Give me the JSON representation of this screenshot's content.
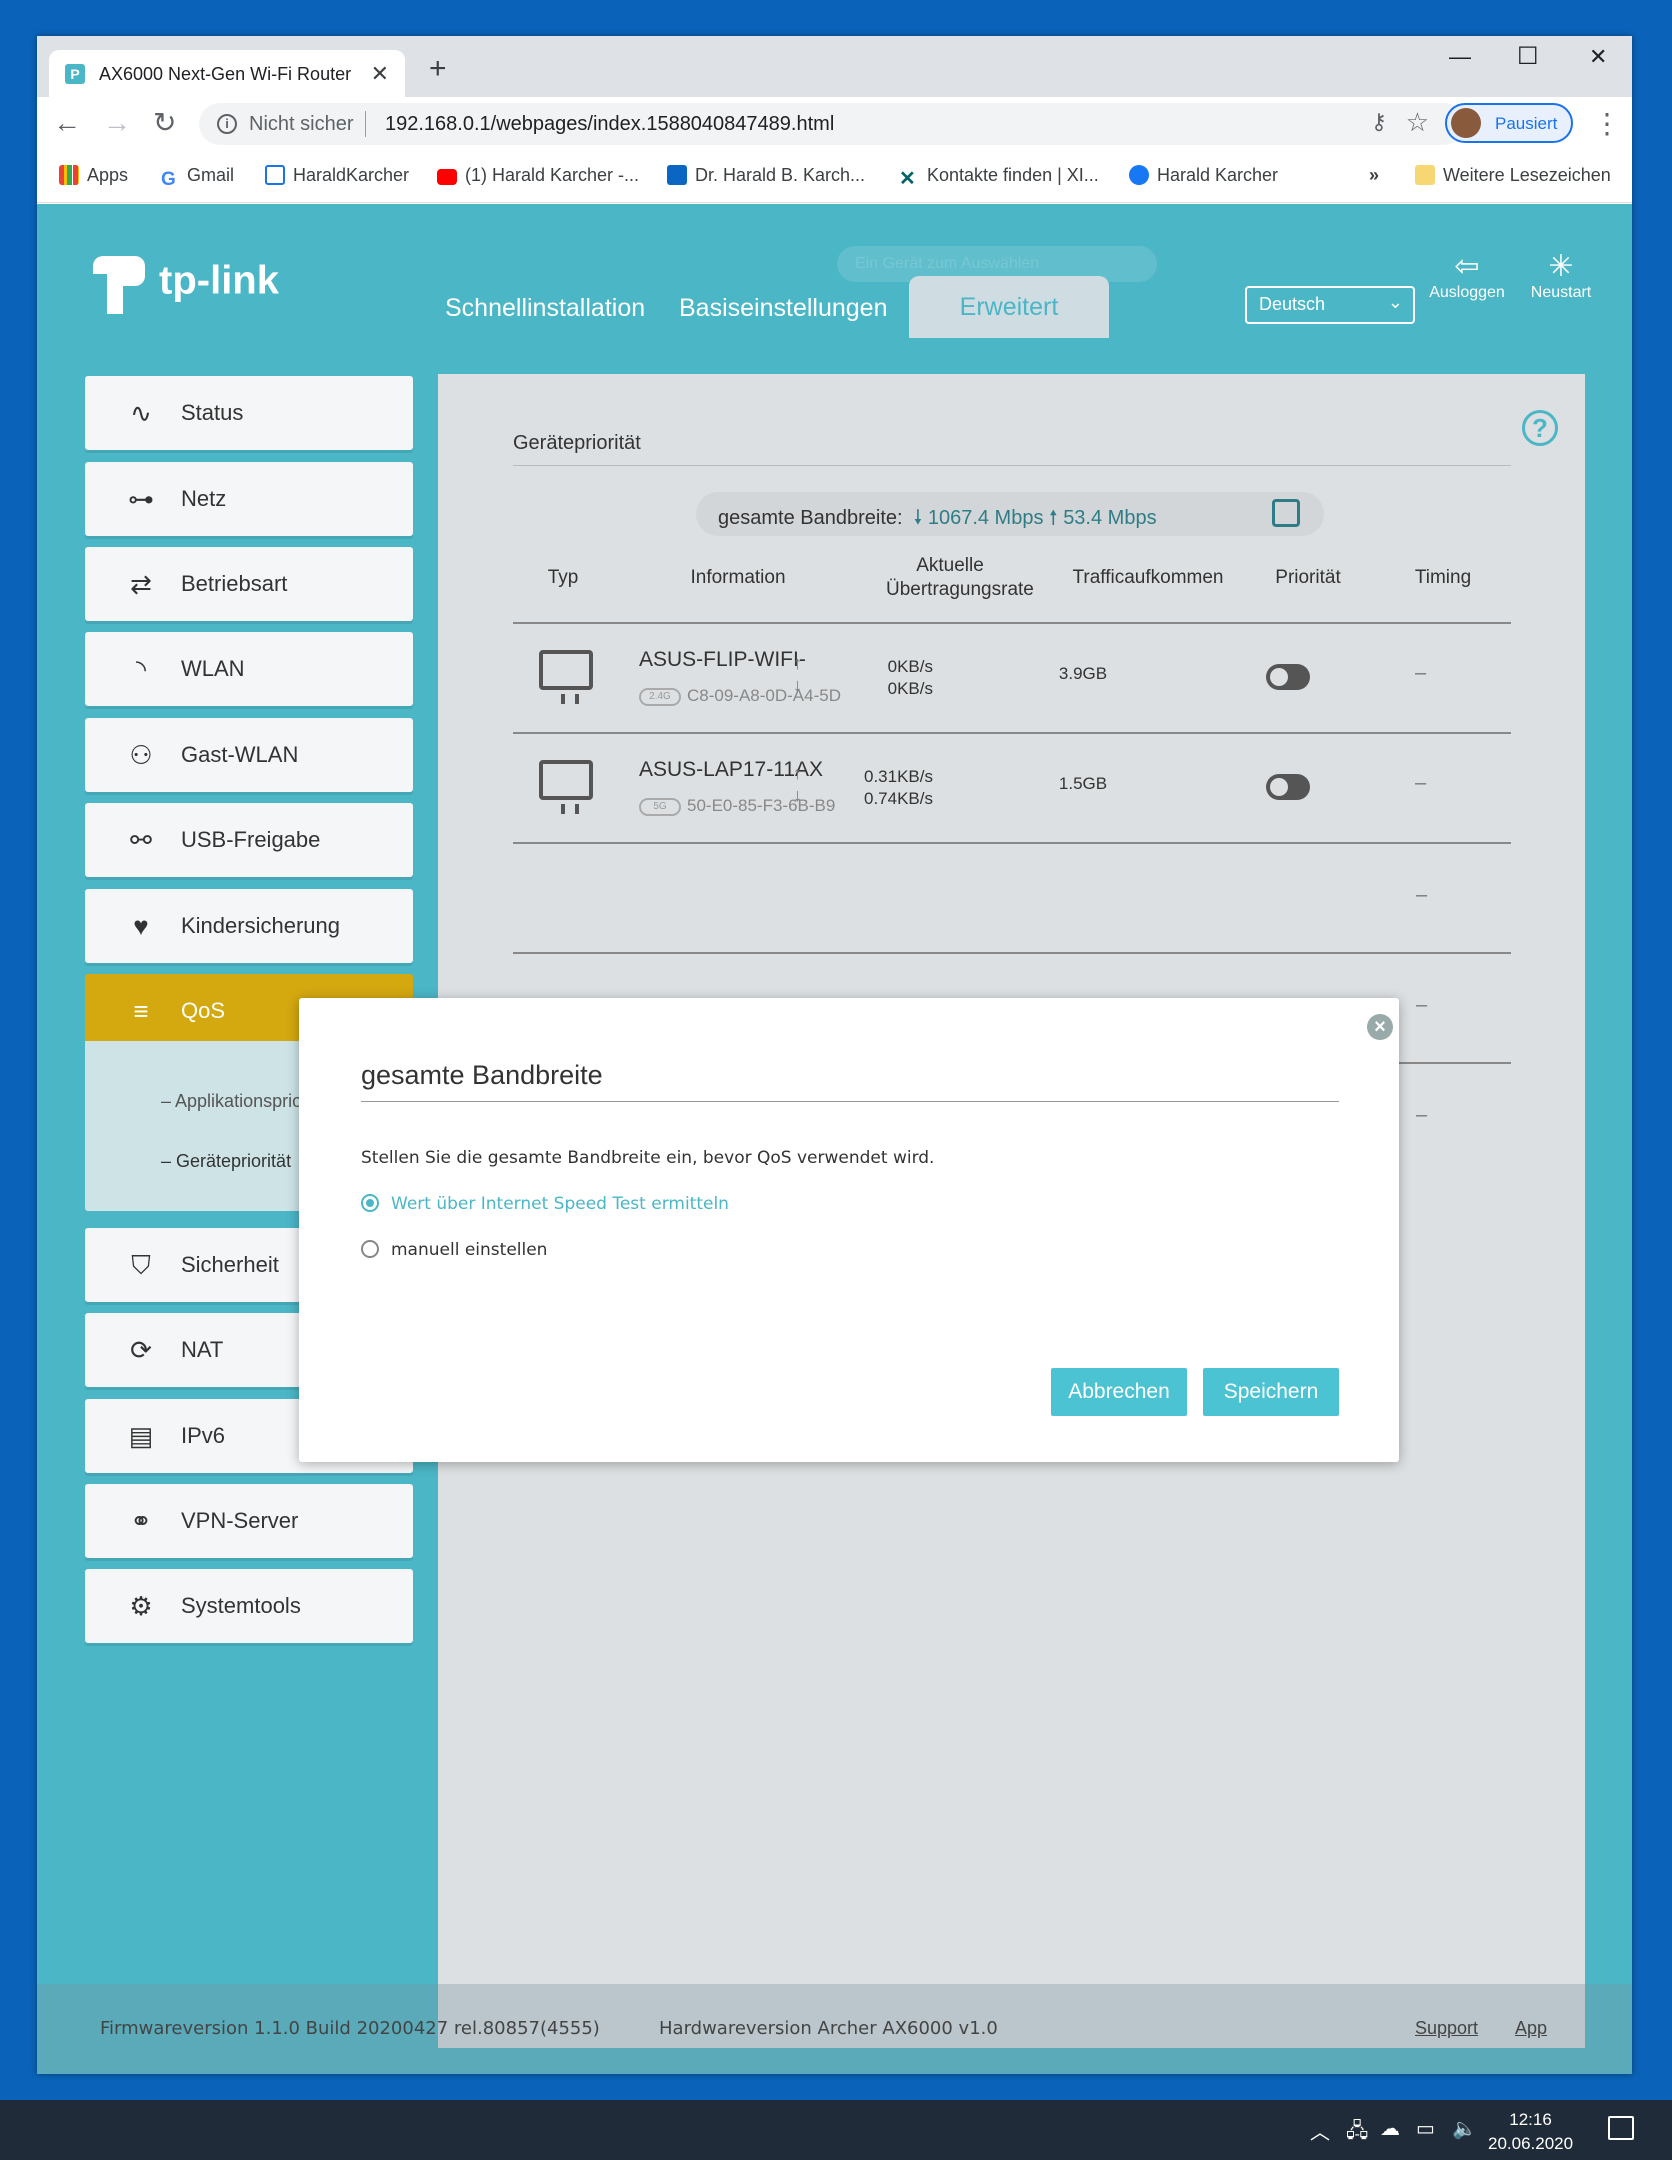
{
  "browser": {
    "tab_title": "AX6000 Next-Gen Wi-Fi Router",
    "tab_favicon": "tp-link-icon",
    "not_secure": "Nicht sicher",
    "url": "192.168.0.1/webpages/index.1588040847489.html",
    "profile_label": "Pausiert",
    "bookmarks": [
      {
        "label": "Apps",
        "icon": "apps-grid-icon"
      },
      {
        "label": "Gmail",
        "icon": "google-icon"
      },
      {
        "label": "HaraldKarcher",
        "icon": "page-icon"
      },
      {
        "label": "(1) Harald Karcher -...",
        "icon": "youtube-icon"
      },
      {
        "label": "Dr. Harald B. Karch...",
        "icon": "linkedin-icon"
      },
      {
        "label": "Kontakte finden | XI...",
        "icon": "xing-icon"
      },
      {
        "label": "Harald Karcher",
        "icon": "facebook-icon"
      }
    ],
    "bookmarks_overflow": "»",
    "other_bookmarks": "Weitere Lesezeichen"
  },
  "router": {
    "brand": "tp-link",
    "nav": {
      "quick": "Schnellinstallation",
      "basic": "Basiseinstellungen",
      "advanced": "Erweitert"
    },
    "language": "Deutsch",
    "logout": "Ausloggen",
    "reboot": "Neustart",
    "ghost_text": "Ein Gerät zum Auswählen",
    "sidebar": [
      {
        "label": "Status",
        "icon": "status-pulse-icon"
      },
      {
        "label": "Netz",
        "icon": "network-icon"
      },
      {
        "label": "Betriebsart",
        "icon": "mode-switch-icon"
      },
      {
        "label": "WLAN",
        "icon": "wifi-icon"
      },
      {
        "label": "Gast-WLAN",
        "icon": "guest-users-icon"
      },
      {
        "label": "USB-Freigabe",
        "icon": "usb-icon"
      },
      {
        "label": "Kindersicherung",
        "icon": "parental-control-icon"
      },
      {
        "label": "QoS",
        "icon": "qos-icon"
      },
      {
        "label": "Sicherheit",
        "icon": "shield-icon"
      },
      {
        "label": "NAT",
        "icon": "nat-icon"
      },
      {
        "label": "IPv6",
        "icon": "ipv6-icon"
      },
      {
        "label": "VPN-Server",
        "icon": "vpn-link-icon"
      },
      {
        "label": "Systemtools",
        "icon": "gear-icon"
      }
    ],
    "qos_sub": [
      "Applikationspriorität",
      "Gerätepriorität"
    ],
    "content": {
      "title": "Gerätepriorität",
      "bandwidth_label": "gesamte Bandbreite:",
      "bandwidth_down": "1067.4 Mbps",
      "bandwidth_up": "53.4 Mbps",
      "columns": [
        "Typ",
        "Information",
        "Aktuelle Übertragungsrate",
        "Trafficaufkommen",
        "Priorität",
        "Timing"
      ],
      "devices": [
        {
          "name": "ASUS-FLIP-WIFI-",
          "band": "2.4G",
          "mac": "C8-09-A8-0D-A4-5D",
          "up": "0KB/s",
          "down": "0KB/s",
          "traffic": "3.9GB",
          "priority": false,
          "timing": "–"
        },
        {
          "name": "ASUS-LAP17-11AX",
          "band": "5G",
          "mac": "50-E0-85-F3-6B-B9",
          "up": "0.31KB/s",
          "down": "0.74KB/s",
          "traffic": "1.5GB",
          "priority": false,
          "timing": "–"
        }
      ],
      "extra_timing": [
        "–",
        "–",
        "–"
      ]
    },
    "modal": {
      "title": "gesamte Bandbreite",
      "description": "Stellen Sie die gesamte Bandbreite ein, bevor QoS verwendet wird.",
      "option_speedtest": "Wert über Internet Speed Test ermitteln",
      "option_manual": "manuell einstellen",
      "selected_option": "speedtest",
      "cancel": "Abbrechen",
      "save": "Speichern"
    },
    "footer": {
      "firmware": "Firmwareversion 1.1.0 Build 20200427 rel.80857(4555)",
      "hardware": "Hardwareversion Archer AX6000 v1.0",
      "support": "Support",
      "app": "App"
    }
  },
  "taskbar": {
    "time": "12:16",
    "date": "20.06.2020"
  },
  "colors": {
    "accent": "#4bb6c6",
    "active_menu": "#d4a80f",
    "desktop": "#0a63b8"
  }
}
